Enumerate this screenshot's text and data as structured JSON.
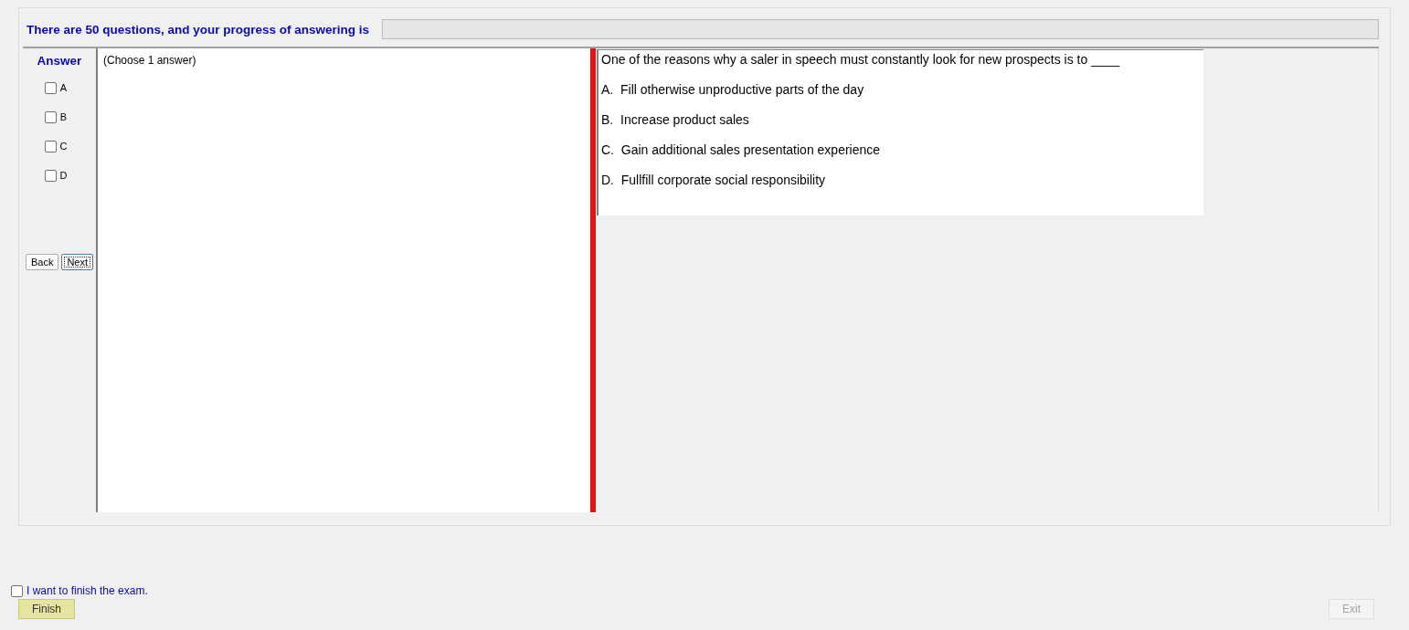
{
  "header": {
    "text": "There are 50 questions, and your progress of answering is",
    "progress": {
      "level": 0
    }
  },
  "answer_panel": {
    "title": "Answer",
    "options": [
      {
        "label": "A",
        "checked": false
      },
      {
        "label": "B",
        "checked": false
      },
      {
        "label": "C",
        "checked": false
      },
      {
        "label": "D",
        "checked": false
      }
    ],
    "buttons": [
      {
        "label": "Back",
        "focused": false
      },
      {
        "label": "Next",
        "focused": true
      }
    ]
  },
  "answer_area": {
    "hint": "(Choose 1 answer)"
  },
  "question": {
    "text": "One of the reasons why a saler in speech must constantly look for new prospects is to ____",
    "choices": [
      "A.  Fill otherwise unproductive parts of the day",
      "B.  Increase product sales",
      "C.  Gain additional sales presentation experience",
      "D.  Fullfill corporate social responsibility"
    ]
  },
  "footer": {
    "finish_check": {
      "label": "I want to finish the exam.",
      "checked": false
    },
    "finish_button": {
      "label": "Finish",
      "disabled": false
    },
    "exit_button": {
      "label": "Exit",
      "disabled": true
    }
  }
}
